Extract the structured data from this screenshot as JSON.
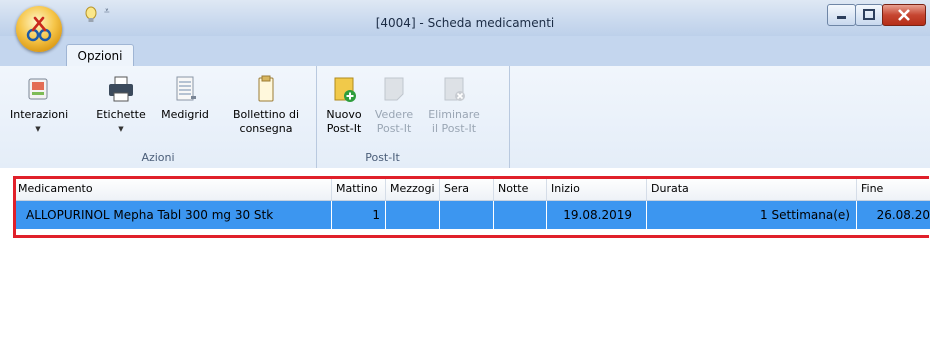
{
  "window": {
    "title": "[4004] - Scheda medicamenti"
  },
  "ribbon": {
    "tabs": [
      {
        "label": "Opzioni"
      }
    ],
    "groups": [
      {
        "label": "Azioni",
        "buttons": [
          {
            "label": "Interazioni",
            "icon": "interactions-icon",
            "dropdown": true
          },
          {
            "label": "Etichette",
            "icon": "printer-icon",
            "dropdown": true
          },
          {
            "label": "Medigrid",
            "icon": "medigrid-icon"
          },
          {
            "label": "Bollettino di consegna",
            "icon": "clipboard-icon"
          }
        ]
      },
      {
        "label": "Post-It",
        "buttons": [
          {
            "label": "Nuovo Post-It",
            "icon": "new-postit-icon",
            "enabled": true
          },
          {
            "label": "Vedere Post-It",
            "icon": "view-postit-icon",
            "enabled": false
          },
          {
            "label": "Eliminare il Post-It",
            "icon": "delete-postit-icon",
            "enabled": false
          }
        ]
      }
    ]
  },
  "grid": {
    "columns": [
      "Medicamento",
      "Mattino",
      "Mezzogi",
      "Sera",
      "Notte",
      "Inizio",
      "Durata",
      "Fine"
    ],
    "rows": [
      {
        "medicamento": "ALLOPURINOL Mepha Tabl 300 mg 30 Stk",
        "mattino": "1",
        "mezzogiorno": "",
        "sera": "",
        "notte": "",
        "inizio": "19.08.2019",
        "durata": "1 Settimana(e)",
        "fine": "26.08.20"
      }
    ],
    "selection_color": "#3c96f0",
    "highlight_color": "#e0202a"
  }
}
